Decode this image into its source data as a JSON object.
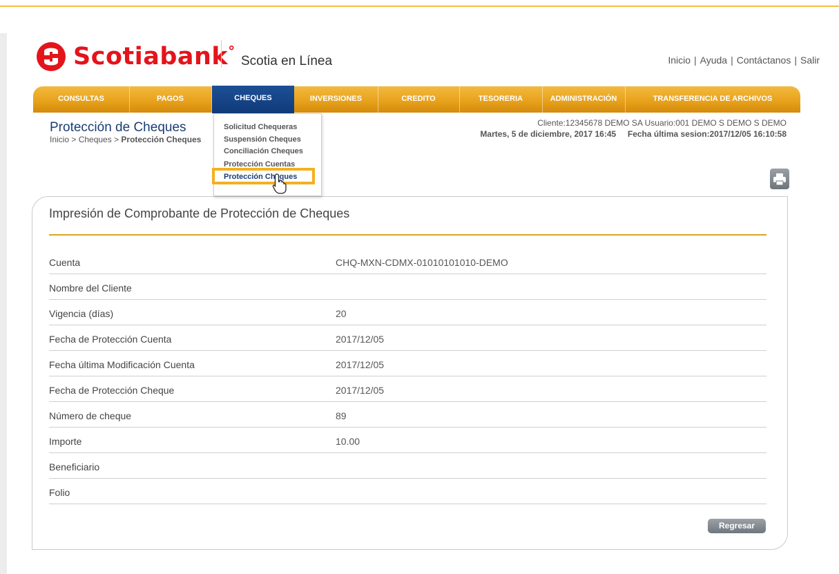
{
  "header": {
    "logo_text": "Scotiabank",
    "logo_mark": "°",
    "subtitle": "Scotia en Línea",
    "links": [
      "Inicio",
      "Ayuda",
      "Contáctanos",
      "Salir"
    ]
  },
  "nav": {
    "items": [
      "CONSULTAS",
      "PAGOS",
      "CHEQUES",
      "INVERSIONES",
      "CREDITO",
      "TESORERIA",
      "ADMINISTRACIÓN",
      "TRANSFERENCIA DE ARCHIVOS"
    ],
    "active": "CHEQUES"
  },
  "dropdown": {
    "items": [
      "Solicitud Chequeras",
      "Suspensión Cheques",
      "Conciliación Cheques",
      "Protección Cuentas",
      "Protección Cheques"
    ],
    "highlighted": "Protección Cheques"
  },
  "page": {
    "title": "Protección de Cheques",
    "breadcrumb_path": "Inicio > Cheques > ",
    "breadcrumb_current": "Protección Cheques"
  },
  "client": {
    "line1": "Cliente:12345678  DEMO SA   Usuario:001 DEMO S DEMO S DEMO",
    "date": "Martes, 5 de diciembre, 2017 16:45",
    "last_session": "Fecha última sesion:2017/12/05 16:10:58"
  },
  "panel": {
    "title": "Impresión de Comprobante de Protección de Cheques",
    "rows": [
      {
        "label": "Cuenta",
        "value": "CHQ-MXN-CDMX-01010101010-DEMO"
      },
      {
        "label": "Nombre del Cliente",
        "value": ""
      },
      {
        "label": "Vigencia (días)",
        "value": "20"
      },
      {
        "label": "Fecha de Protección Cuenta",
        "value": "2017/12/05"
      },
      {
        "label": "Fecha última Modificación Cuenta",
        "value": "2017/12/05"
      },
      {
        "label": "Fecha de Protección Cheque",
        "value": "2017/12/05"
      },
      {
        "label": "Número de cheque",
        "value": "89"
      },
      {
        "label": "Importe",
        "value": "10.00"
      },
      {
        "label": "Beneficiario",
        "value": ""
      },
      {
        "label": "Folio",
        "value": ""
      }
    ],
    "back_label": "Regresar"
  },
  "icons": {
    "logo": "scotiabank-globe-icon",
    "print": "printer-icon",
    "cursor": "hand-pointer-icon"
  },
  "colors": {
    "brand_red": "#e4141b",
    "nav_gold": "#e8a31c",
    "nav_active": "#1d4f96",
    "highlight": "#f4b020",
    "title_blue": "#1a3d75"
  }
}
